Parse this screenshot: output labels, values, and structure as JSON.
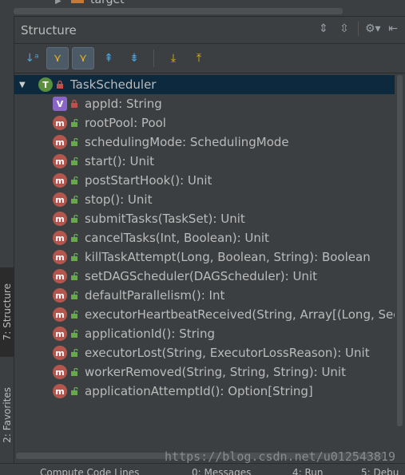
{
  "top": {
    "node_label": "target"
  },
  "panel": {
    "title": "Structure"
  },
  "side_tabs": {
    "structure": "7: Structure",
    "favorites": "2: Favorites"
  },
  "tree": {
    "root": {
      "badge": "T",
      "label": "TaskScheduler"
    },
    "items": [
      {
        "badge": "V",
        "kind": "v",
        "vis": "private",
        "label": "appId: String"
      },
      {
        "badge": "m",
        "kind": "m",
        "vis": "public",
        "label": "rootPool: Pool"
      },
      {
        "badge": "m",
        "kind": "m",
        "vis": "public",
        "label": "schedulingMode: SchedulingMode"
      },
      {
        "badge": "m",
        "kind": "m",
        "vis": "public",
        "label": "start(): Unit"
      },
      {
        "badge": "m",
        "kind": "m",
        "vis": "public",
        "label": "postStartHook(): Unit"
      },
      {
        "badge": "m",
        "kind": "m",
        "vis": "public",
        "label": "stop(): Unit"
      },
      {
        "badge": "m",
        "kind": "m",
        "vis": "public",
        "label": "submitTasks(TaskSet): Unit"
      },
      {
        "badge": "m",
        "kind": "m",
        "vis": "public",
        "label": "cancelTasks(Int, Boolean): Unit"
      },
      {
        "badge": "m",
        "kind": "m",
        "vis": "public",
        "label": "killTaskAttempt(Long, Boolean, String): Boolean"
      },
      {
        "badge": "m",
        "kind": "m",
        "vis": "public",
        "label": "setDAGScheduler(DAGScheduler): Unit"
      },
      {
        "badge": "m",
        "kind": "m",
        "vis": "public",
        "label": "defaultParallelism(): Int"
      },
      {
        "badge": "m",
        "kind": "m",
        "vis": "public",
        "label": "executorHeartbeatReceived(String, Array[(Long, Sec"
      },
      {
        "badge": "m",
        "kind": "m",
        "vis": "public",
        "label": "applicationId(): String"
      },
      {
        "badge": "m",
        "kind": "m",
        "vis": "public",
        "label": "executorLost(String, ExecutorLossReason): Unit"
      },
      {
        "badge": "m",
        "kind": "m",
        "vis": "public",
        "label": "workerRemoved(String, String, String): Unit"
      },
      {
        "badge": "m",
        "kind": "m",
        "vis": "public",
        "label": "applicationAttemptId(): Option[String]"
      }
    ]
  },
  "watermark": "https://blog.csdn.net/u012543819",
  "bottom_bar": {
    "left": "Compute Code Lines",
    "messages": "0: Messages",
    "run": "4: Run",
    "debug": "5: Debu"
  }
}
